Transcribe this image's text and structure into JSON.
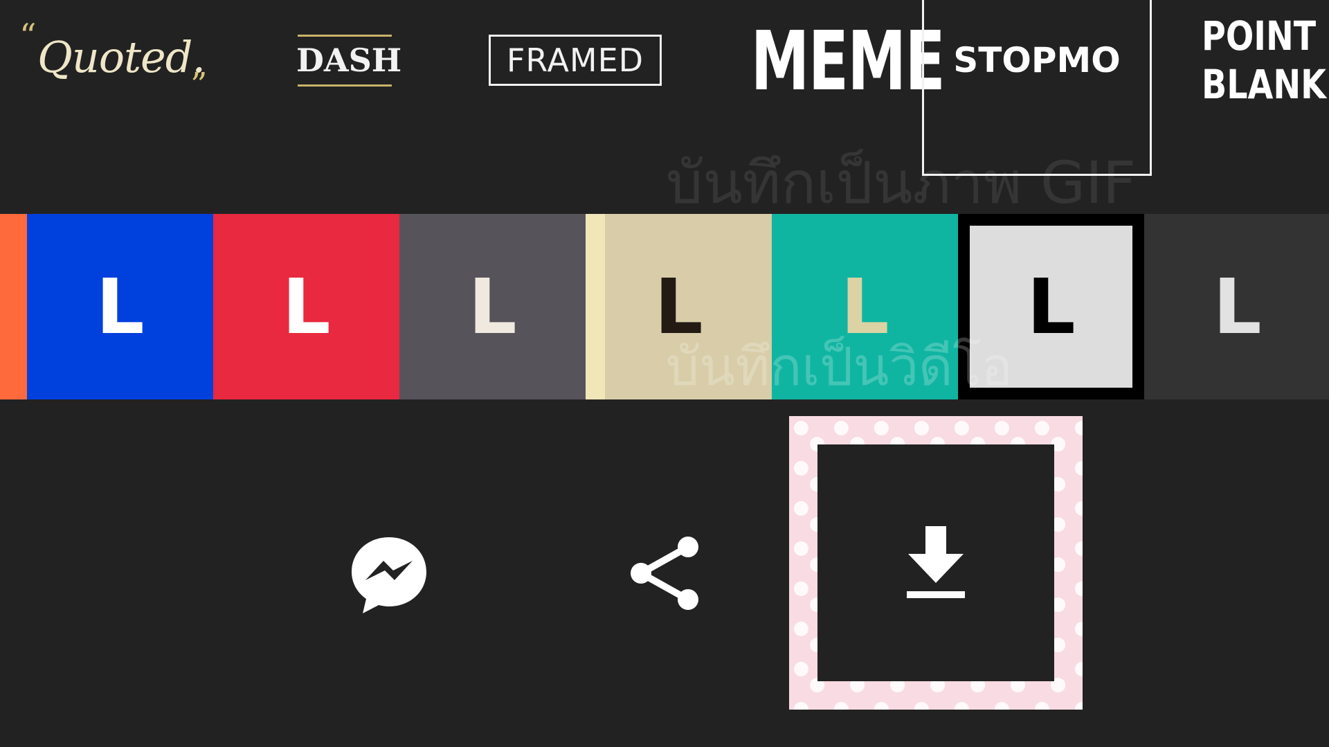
{
  "styles": {
    "quoted": {
      "open_quote": "“",
      "label": "Quoted.",
      "close_quote": "”"
    },
    "dash": {
      "label": "DASH"
    },
    "framed": {
      "label": "FRAMED"
    },
    "meme": {
      "label": "MEME"
    },
    "stopmo": {
      "label": "STOPMO",
      "selected": true
    },
    "point_blank": {
      "line1": "POINT",
      "line2": "BLANK."
    }
  },
  "hints": {
    "save_gif": "บันทึกเป็นภาพ GIF",
    "save_video": "บันทึกเป็นวิดีโอ"
  },
  "swatches": [
    {
      "letter": "L",
      "bg": "#0040dd",
      "fg": "#ffffff"
    },
    {
      "letter": "L",
      "bg": "#e8293f",
      "fg": "#ffffff"
    },
    {
      "letter": "L",
      "bg": "#57535a",
      "fg": "#efe9df"
    },
    {
      "letter": "L",
      "bg": "#d8cda8",
      "fg": "#231a14",
      "stripe": "#f1e6b8"
    },
    {
      "letter": "L",
      "bg": "#10b5a2",
      "fg": "#dcd3a4"
    },
    {
      "letter": "L",
      "bg": "#dddddd",
      "fg": "#000000",
      "selected": true
    },
    {
      "letter": "L",
      "bg": "#333333",
      "fg": "#e2e2e2"
    }
  ],
  "edge_swatch_color": "#ff6a3d",
  "actions": {
    "messenger_icon": "messenger-icon",
    "share_icon": "share-icon",
    "save_icon": "download-icon",
    "save_frame_color": "#f8dbe3"
  }
}
